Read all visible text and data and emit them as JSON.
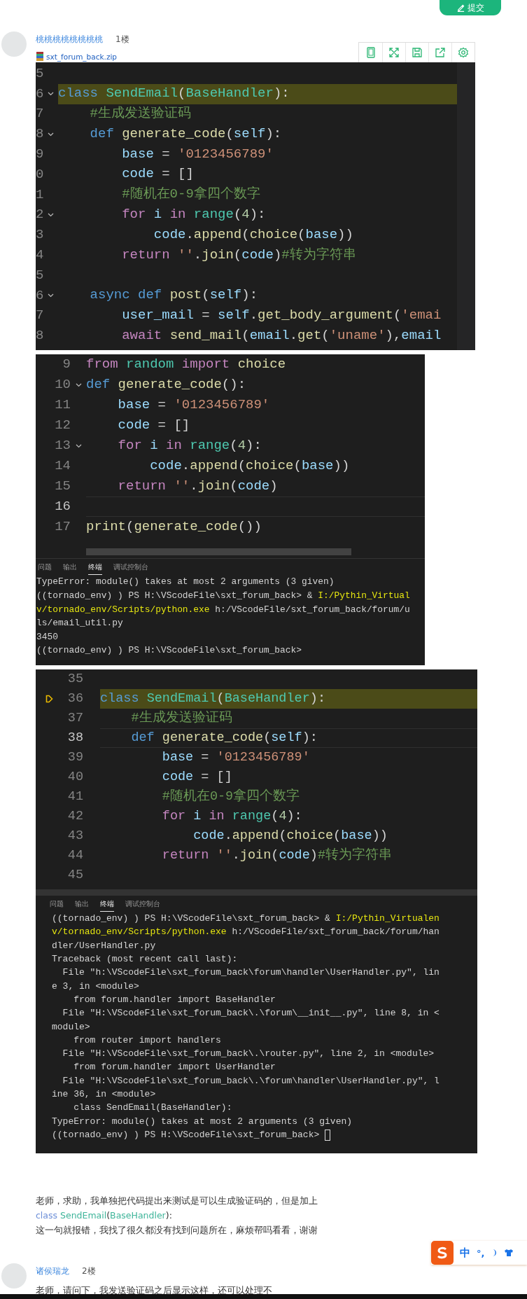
{
  "header": {
    "submit_button": "提交"
  },
  "first_post": {
    "author": "桃桃桃桃桃桃桃桃",
    "floor": "1楼",
    "attachment": "sxt_forum_back.zip",
    "screenshots": [
      {
        "editor": {
          "lines": [
            {
              "number": "5",
              "kind": "plain",
              "highlighted": false
            },
            {
              "number": "6",
              "kind": "fold",
              "highlighted": true,
              "tokens": [
                {
                  "text": "class ",
                  "kind": "kw"
                },
                {
                  "text": "SendEmail",
                  "kind": "cls"
                },
                {
                  "text": "(",
                  "kind": "p"
                },
                {
                  "text": "BaseHandler",
                  "kind": "cls"
                },
                {
                  "text": "):",
                  "kind": "p"
                }
              ]
            },
            {
              "number": "7",
              "kind": "plain",
              "highlighted": false,
              "tokens": [
                {
                  "text": "    #生成发送验证码",
                  "kind": "cmt"
                }
              ]
            },
            {
              "number": "8",
              "kind": "fold",
              "highlighted": false,
              "tokens": [
                {
                  "text": "    def ",
                  "kind": "kw"
                },
                {
                  "text": "generate_code",
                  "kind": "fn"
                },
                {
                  "text": "(",
                  "kind": "p"
                },
                {
                  "text": "self",
                  "kind": "var"
                },
                {
                  "text": "):",
                  "kind": "p"
                }
              ]
            },
            {
              "number": "9",
              "kind": "plain",
              "highlighted": false,
              "tokens": [
                {
                  "text": "        base",
                  "kind": "var"
                },
                {
                  "text": " = ",
                  "kind": "p"
                },
                {
                  "text": "'0123456789'",
                  "kind": "str"
                }
              ]
            },
            {
              "number": "0",
              "kind": "plain",
              "highlighted": false,
              "tokens": [
                {
                  "text": "        code",
                  "kind": "var"
                },
                {
                  "text": " = []",
                  "kind": "p"
                }
              ]
            },
            {
              "number": "1",
              "kind": "plain",
              "highlighted": false,
              "tokens": [
                {
                  "text": "        #随机在0-9拿四个数字",
                  "kind": "cmt"
                }
              ]
            },
            {
              "number": "2",
              "kind": "fold",
              "highlighted": false,
              "tokens": [
                {
                  "text": "        for ",
                  "kind": "ctl"
                },
                {
                  "text": "i ",
                  "kind": "var"
                },
                {
                  "text": "in ",
                  "kind": "ctl"
                },
                {
                  "text": "range",
                  "kind": "cls"
                },
                {
                  "text": "(",
                  "kind": "p"
                },
                {
                  "text": "4",
                  "kind": "num"
                },
                {
                  "text": "):",
                  "kind": "p"
                }
              ]
            },
            {
              "number": "3",
              "kind": "plain",
              "highlighted": false,
              "tokens": [
                {
                  "text": "            code",
                  "kind": "var"
                },
                {
                  "text": ".",
                  "kind": "p"
                },
                {
                  "text": "append",
                  "kind": "fn"
                },
                {
                  "text": "(",
                  "kind": "p"
                },
                {
                  "text": "choice",
                  "kind": "fn"
                },
                {
                  "text": "(",
                  "kind": "p"
                },
                {
                  "text": "base",
                  "kind": "var"
                },
                {
                  "text": "))",
                  "kind": "p"
                }
              ]
            },
            {
              "number": "4",
              "kind": "plain",
              "highlighted": false,
              "tokens": [
                {
                  "text": "        return ",
                  "kind": "ctl"
                },
                {
                  "text": "''",
                  "kind": "str"
                },
                {
                  "text": ".",
                  "kind": "p"
                },
                {
                  "text": "join",
                  "kind": "fn"
                },
                {
                  "text": "(",
                  "kind": "p"
                },
                {
                  "text": "code",
                  "kind": "var"
                },
                {
                  "text": ")",
                  "kind": "p"
                },
                {
                  "text": "#转为字符串",
                  "kind": "cmt"
                }
              ]
            },
            {
              "number": "5",
              "kind": "plain",
              "highlighted": false
            },
            {
              "number": "6",
              "kind": "fold",
              "highlighted": false,
              "tokens": [
                {
                  "text": "    async def ",
                  "kind": "kw"
                },
                {
                  "text": "post",
                  "kind": "fn"
                },
                {
                  "text": "(",
                  "kind": "p"
                },
                {
                  "text": "self",
                  "kind": "var"
                },
                {
                  "text": "):",
                  "kind": "p"
                }
              ]
            },
            {
              "number": "7",
              "kind": "plain",
              "highlighted": false,
              "tokens": [
                {
                  "text": "        user_mail",
                  "kind": "var"
                },
                {
                  "text": " = ",
                  "kind": "p"
                },
                {
                  "text": "self",
                  "kind": "var"
                },
                {
                  "text": ".",
                  "kind": "p"
                },
                {
                  "text": "get_body_argument",
                  "kind": "fn"
                },
                {
                  "text": "(",
                  "kind": "p"
                },
                {
                  "text": "'emai",
                  "kind": "str"
                }
              ]
            },
            {
              "number": "8",
              "kind": "plain",
              "highlighted": false,
              "tokens": [
                {
                  "text": "        await ",
                  "kind": "ctl"
                },
                {
                  "text": "send_mail",
                  "kind": "fn"
                },
                {
                  "text": "(",
                  "kind": "p"
                },
                {
                  "text": "email",
                  "kind": "var"
                },
                {
                  "text": ".",
                  "kind": "p"
                },
                {
                  "text": "get",
                  "kind": "fn"
                },
                {
                  "text": "(",
                  "kind": "p"
                },
                {
                  "text": "'uname'",
                  "kind": "str"
                },
                {
                  "text": "),",
                  "kind": "p"
                },
                {
                  "text": "email",
                  "kind": "var"
                }
              ]
            }
          ]
        }
      },
      {
        "editor": {
          "lines": [
            {
              "number": "9",
              "kind": "plain",
              "highlighted": false,
              "tokens": [
                {
                  "text": "from ",
                  "kind": "ctl"
                },
                {
                  "text": "random ",
                  "kind": "cls"
                },
                {
                  "text": "import ",
                  "kind": "ctl"
                },
                {
                  "text": "choice",
                  "kind": "fn"
                }
              ]
            },
            {
              "number": "10",
              "kind": "fold",
              "highlighted": false,
              "tokens": [
                {
                  "text": "def ",
                  "kind": "kw"
                },
                {
                  "text": "generate_code",
                  "kind": "fn"
                },
                {
                  "text": "():",
                  "kind": "p"
                }
              ]
            },
            {
              "number": "11",
              "kind": "plain",
              "highlighted": false,
              "tokens": [
                {
                  "text": "    base",
                  "kind": "var"
                },
                {
                  "text": " = ",
                  "kind": "p"
                },
                {
                  "text": "'0123456789'",
                  "kind": "str"
                }
              ]
            },
            {
              "number": "12",
              "kind": "plain",
              "highlighted": false,
              "tokens": [
                {
                  "text": "    code",
                  "kind": "var"
                },
                {
                  "text": " = []",
                  "kind": "p"
                }
              ]
            },
            {
              "number": "13",
              "kind": "fold",
              "highlighted": false,
              "tokens": [
                {
                  "text": "    for ",
                  "kind": "ctl"
                },
                {
                  "text": "i ",
                  "kind": "var"
                },
                {
                  "text": "in ",
                  "kind": "ctl"
                },
                {
                  "text": "range",
                  "kind": "cls"
                },
                {
                  "text": "(",
                  "kind": "p"
                },
                {
                  "text": "4",
                  "kind": "num"
                },
                {
                  "text": "):",
                  "kind": "p"
                }
              ]
            },
            {
              "number": "14",
              "kind": "plain",
              "highlighted": false,
              "tokens": [
                {
                  "text": "        code",
                  "kind": "var"
                },
                {
                  "text": ".",
                  "kind": "p"
                },
                {
                  "text": "append",
                  "kind": "fn"
                },
                {
                  "text": "(",
                  "kind": "p"
                },
                {
                  "text": "choice",
                  "kind": "fn"
                },
                {
                  "text": "(",
                  "kind": "p"
                },
                {
                  "text": "base",
                  "kind": "var"
                },
                {
                  "text": "))",
                  "kind": "p"
                }
              ]
            },
            {
              "number": "15",
              "kind": "plain",
              "highlighted": false,
              "tokens": [
                {
                  "text": "    return ",
                  "kind": "ctl"
                },
                {
                  "text": "''",
                  "kind": "str"
                },
                {
                  "text": ".",
                  "kind": "p"
                },
                {
                  "text": "join",
                  "kind": "fn"
                },
                {
                  "text": "(",
                  "kind": "p"
                },
                {
                  "text": "code",
                  "kind": "var"
                },
                {
                  "text": ")",
                  "kind": "p"
                }
              ]
            },
            {
              "number": "16",
              "kind": "current",
              "highlighted": false
            },
            {
              "number": "17",
              "kind": "plain",
              "highlighted": false,
              "tokens": [
                {
                  "text": "print",
                  "kind": "fn"
                },
                {
                  "text": "(",
                  "kind": "p"
                },
                {
                  "text": "generate_code",
                  "kind": "fn"
                },
                {
                  "text": "())",
                  "kind": "p"
                }
              ]
            }
          ]
        },
        "terminal": {
          "tabs": [
            {
              "label": "问题",
              "selected": false
            },
            {
              "label": "输出",
              "selected": false
            },
            {
              "label": "终端",
              "selected": true
            },
            {
              "label": "调试控制台",
              "selected": false
            }
          ],
          "cursor": false,
          "lines": [
            [
              {
                "text": "TypeError: module() takes at most 2 arguments (3 given)",
                "kind": "p"
              }
            ],
            [
              {
                "text": "((tornado_env) ) PS H:\\VScodeFile\\sxt_forum_back> & ",
                "kind": "p"
              },
              {
                "text": "I:/Pythin_Virtual",
                "kind": "path"
              }
            ],
            [
              {
                "text": "v/tornado_env/Scripts/python.exe",
                "kind": "path"
              },
              {
                "text": " h:/VScodeFile/sxt_forum_back/forum/u",
                "kind": "p"
              }
            ],
            [
              {
                "text": "ls/email_util.py",
                "kind": "p"
              }
            ],
            [
              {
                "text": "3450",
                "kind": "p"
              }
            ],
            [
              {
                "text": "((tornado_env) ) PS H:\\VScodeFile\\sxt_forum_back>",
                "kind": "p"
              }
            ]
          ]
        }
      },
      {
        "editor": {
          "lines": [
            {
              "number": "35",
              "kind": "plain",
              "highlighted": false
            },
            {
              "number": "36",
              "kind": "paused",
              "highlighted": true,
              "tokens": [
                {
                  "text": "class ",
                  "kind": "kw"
                },
                {
                  "text": "SendEmail",
                  "kind": "cls"
                },
                {
                  "text": "(",
                  "kind": "p"
                },
                {
                  "text": "BaseHandler",
                  "kind": "cls"
                },
                {
                  "text": "):",
                  "kind": "p"
                }
              ]
            },
            {
              "number": "37",
              "kind": "plain",
              "highlighted": false,
              "tokens": [
                {
                  "text": "    #生成发送验证码",
                  "kind": "cmt"
                }
              ]
            },
            {
              "number": "38",
              "kind": "current",
              "highlighted": false,
              "tokens": [
                {
                  "text": "    def ",
                  "kind": "kw"
                },
                {
                  "text": "generate_code",
                  "kind": "fn"
                },
                {
                  "text": "(",
                  "kind": "p"
                },
                {
                  "text": "self",
                  "kind": "var"
                },
                {
                  "text": "):",
                  "kind": "p"
                }
              ]
            },
            {
              "number": "39",
              "kind": "plain",
              "highlighted": false,
              "tokens": [
                {
                  "text": "        base",
                  "kind": "var"
                },
                {
                  "text": " = ",
                  "kind": "p"
                },
                {
                  "text": "'0123456789'",
                  "kind": "str"
                }
              ]
            },
            {
              "number": "40",
              "kind": "plain",
              "highlighted": false,
              "tokens": [
                {
                  "text": "        code",
                  "kind": "var"
                },
                {
                  "text": " = []",
                  "kind": "p"
                }
              ]
            },
            {
              "number": "41",
              "kind": "plain",
              "highlighted": false,
              "tokens": [
                {
                  "text": "        #随机在0-9拿四个数字",
                  "kind": "cmt"
                }
              ]
            },
            {
              "number": "42",
              "kind": "plain",
              "highlighted": false,
              "tokens": [
                {
                  "text": "        for ",
                  "kind": "ctl"
                },
                {
                  "text": "i ",
                  "kind": "var"
                },
                {
                  "text": "in ",
                  "kind": "ctl"
                },
                {
                  "text": "range",
                  "kind": "cls"
                },
                {
                  "text": "(",
                  "kind": "p"
                },
                {
                  "text": "4",
                  "kind": "num"
                },
                {
                  "text": "):",
                  "kind": "p"
                }
              ]
            },
            {
              "number": "43",
              "kind": "plain",
              "highlighted": false,
              "tokens": [
                {
                  "text": "            code",
                  "kind": "var"
                },
                {
                  "text": ".",
                  "kind": "p"
                },
                {
                  "text": "append",
                  "kind": "fn"
                },
                {
                  "text": "(",
                  "kind": "p"
                },
                {
                  "text": "choice",
                  "kind": "fn"
                },
                {
                  "text": "(",
                  "kind": "p"
                },
                {
                  "text": "base",
                  "kind": "var"
                },
                {
                  "text": "))",
                  "kind": "p"
                }
              ]
            },
            {
              "number": "44",
              "kind": "plain",
              "highlighted": false,
              "tokens": [
                {
                  "text": "        return ",
                  "kind": "ctl"
                },
                {
                  "text": "''",
                  "kind": "str"
                },
                {
                  "text": ".",
                  "kind": "p"
                },
                {
                  "text": "join",
                  "kind": "fn"
                },
                {
                  "text": "(",
                  "kind": "p"
                },
                {
                  "text": "code",
                  "kind": "var"
                },
                {
                  "text": ")",
                  "kind": "p"
                },
                {
                  "text": "#转为字符串",
                  "kind": "cmt"
                }
              ]
            },
            {
              "number": "45",
              "kind": "plain",
              "highlighted": false
            }
          ]
        },
        "terminal": {
          "tabs": [
            {
              "label": "问题",
              "selected": false
            },
            {
              "label": "输出",
              "selected": false
            },
            {
              "label": "终端",
              "selected": true
            },
            {
              "label": "调试控制台",
              "selected": false
            }
          ],
          "cursor": true,
          "lines": [
            [
              {
                "text": "((tornado_env) ) PS H:\\VScodeFile\\sxt_forum_back> & ",
                "kind": "p"
              },
              {
                "text": "I:/Pythin_Virtualen",
                "kind": "path"
              }
            ],
            [
              {
                "text": "v/tornado_env/Scripts/python.exe",
                "kind": "path"
              },
              {
                "text": " h:/VScodeFile/sxt_forum_back/forum/han",
                "kind": "p"
              }
            ],
            [
              {
                "text": "dler/UserHandler.py",
                "kind": "p"
              }
            ],
            [
              {
                "text": "Traceback (most recent call last):",
                "kind": "p"
              }
            ],
            [
              {
                "text": "  File \"h:\\VScodeFile\\sxt_forum_back\\forum\\handler\\UserHandler.py\", lin",
                "kind": "p"
              }
            ],
            [
              {
                "text": "e 3, in <module>",
                "kind": "p"
              }
            ],
            [
              {
                "text": "    from forum.handler import BaseHandler",
                "kind": "p"
              }
            ],
            [
              {
                "text": "  File \"H:\\VScodeFile\\sxt_forum_back\\.\\forum\\__init__.py\", line 8, in <",
                "kind": "p"
              }
            ],
            [
              {
                "text": "module>",
                "kind": "p"
              }
            ],
            [
              {
                "text": "    from router import handlers",
                "kind": "p"
              }
            ],
            [
              {
                "text": "  File \"H:\\VScodeFile\\sxt_forum_back\\.\\router.py\", line 2, in <module>",
                "kind": "p"
              }
            ],
            [
              {
                "text": "    from forum.handler import UserHandler",
                "kind": "p"
              }
            ],
            [
              {
                "text": "  File \"H:\\VScodeFile\\sxt_forum_back\\.\\forum\\handler\\UserHandler.py\", l",
                "kind": "p"
              }
            ],
            [
              {
                "text": "ine 36, in <module>",
                "kind": "p"
              }
            ],
            [
              {
                "text": "    class SendEmail(BaseHandler):",
                "kind": "p"
              }
            ],
            [
              {
                "text": "TypeError: module() takes at most 2 arguments (3 given)",
                "kind": "p"
              }
            ],
            [
              {
                "text": "((tornado_env) ) PS H:\\VScodeFile\\sxt_forum_back>",
                "kind": "p"
              }
            ]
          ]
        }
      }
    ],
    "message": [
      [
        {
          "text": "老师，求助，我单独把代码提出来测试是可以生成验证码的，但是加上",
          "kind": "p"
        }
      ],
      [
        {
          "text": "class ",
          "kind": "kw"
        },
        {
          "text": "SendEmail",
          "kind": "cls"
        },
        {
          "text": "(",
          "kind": "p"
        },
        {
          "text": "BaseHandler",
          "kind": "cls"
        },
        {
          "text": "):",
          "kind": "p"
        }
      ],
      [
        {
          "text": "这一句就报错，我找了很久都没有找到问题所在，麻烦帮吗看看，谢谢",
          "kind": "p"
        }
      ]
    ]
  },
  "second_post": {
    "author": "诸侯瑞龙",
    "floor": "2楼",
    "message": "老师，请问下，我发送验证码之后显示这样，还可以处理不"
  },
  "ime_toolbar": {
    "language": "中",
    "punctuation": "°,"
  }
}
